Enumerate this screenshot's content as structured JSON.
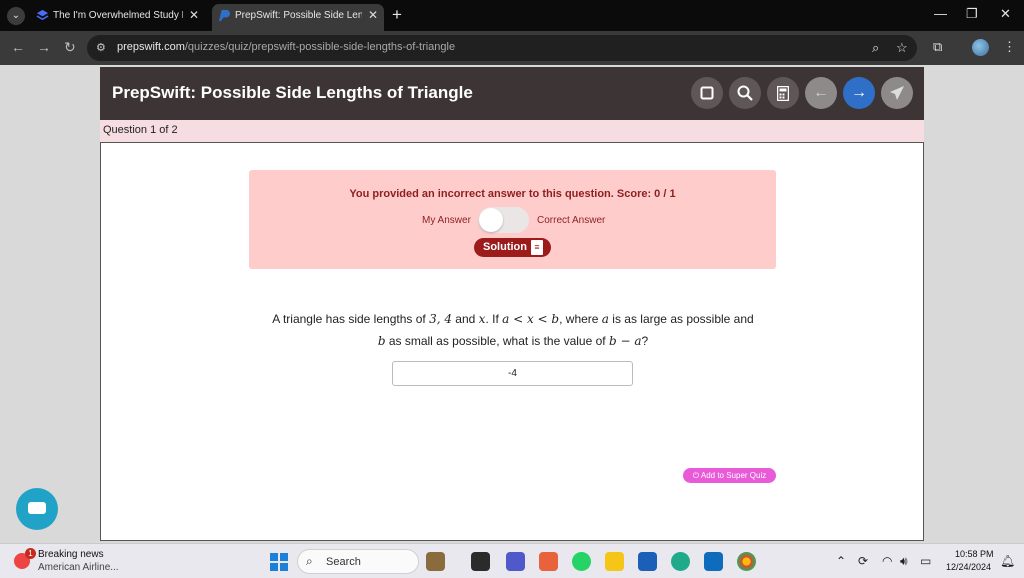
{
  "browser": {
    "tabs": [
      {
        "title": "The I'm Overwhelmed Study Pla",
        "favicon": "layers-icon",
        "active": false
      },
      {
        "title": "PrepSwift: Possible Side Length",
        "favicon": "prepswift-p-icon",
        "active": true
      }
    ],
    "url_domain": "prepswift.com",
    "url_path": "/quizzes/quiz/prepswift-possible-side-lengths-of-triangle"
  },
  "header": {
    "title": "PrepSwift: Possible Side Lengths of Triangle",
    "buttons": [
      "square-icon",
      "search-icon",
      "calculator-icon",
      "arrow-left-icon",
      "arrow-right-icon",
      "send-icon"
    ]
  },
  "question_counter": "Question 1 of 2",
  "feedback": {
    "message": "You provided an incorrect answer to this question. Score: 0 / 1",
    "my_answer_label": "My Answer",
    "correct_answer_label": "Correct Answer",
    "solution_label": "Solution"
  },
  "question": {
    "part1": "A triangle has side lengths of ",
    "part2": " and ",
    "part3": ". If ",
    "part4": ", where ",
    "part5": " is as large as possible and",
    "part6": " as small as possible, what is the value of ",
    "part7": "?",
    "math_sides": "3, 4",
    "math_x": "x",
    "math_ineq": "a < x < b",
    "math_a": "a",
    "math_b": "b",
    "math_expr": "b − a"
  },
  "answer_value": "-4",
  "super_quiz_label": "Add to Super Quiz",
  "taskbar": {
    "news_badge": "1",
    "news_title": "Breaking news",
    "news_subtitle": "American Airline...",
    "search_label": "Search",
    "time": "10:58 PM",
    "date": "12/24/2024"
  },
  "colors": {
    "header_bg": "#3d3535",
    "alert_bg": "#ffcccc",
    "alert_text": "#8e1f1f",
    "solution_bg": "#9c1c1c",
    "nav_blue": "#2f6fc7",
    "super_quiz": "#e85ad8",
    "chat": "#20a3c6"
  }
}
